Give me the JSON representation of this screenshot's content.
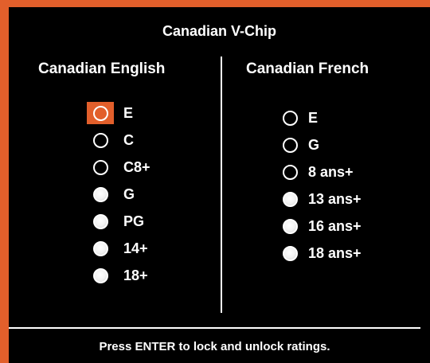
{
  "title": "Canadian V-Chip",
  "english": {
    "heading": "Canadian English",
    "options": [
      {
        "label": "E",
        "state": "unlocked",
        "focused": true
      },
      {
        "label": "C",
        "state": "unlocked",
        "focused": false
      },
      {
        "label": "C8+",
        "state": "unlocked",
        "focused": false
      },
      {
        "label": "G",
        "state": "locked",
        "focused": false
      },
      {
        "label": "PG",
        "state": "locked",
        "focused": false
      },
      {
        "label": "14+",
        "state": "locked",
        "focused": false
      },
      {
        "label": "18+",
        "state": "locked",
        "focused": false
      }
    ]
  },
  "french": {
    "heading": "Canadian French",
    "options": [
      {
        "label": "E",
        "state": "unlocked"
      },
      {
        "label": "G",
        "state": "unlocked"
      },
      {
        "label": "8 ans+",
        "state": "unlocked"
      },
      {
        "label": "13 ans+",
        "state": "locked"
      },
      {
        "label": "16 ans+",
        "state": "locked"
      },
      {
        "label": "18 ans+",
        "state": "locked"
      }
    ]
  },
  "footer": "Press ENTER to lock and unlock ratings.",
  "colors": {
    "accent": "#e25f2b",
    "background": "#000000",
    "text": "#ffffff"
  }
}
